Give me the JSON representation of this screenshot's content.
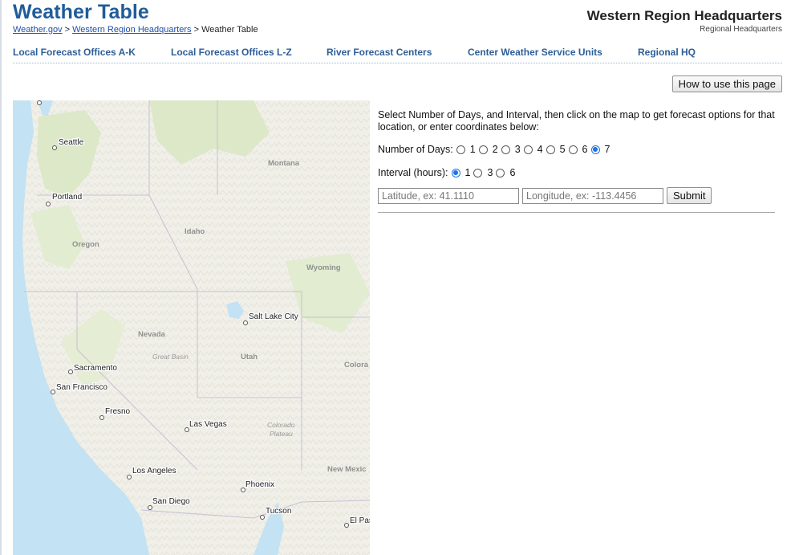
{
  "header": {
    "title": "Weather Table",
    "breadcrumb": [
      {
        "label": "Weather.gov",
        "link": true
      },
      {
        "label": "Western Region Headquarters",
        "link": true
      },
      {
        "label": "Weather Table",
        "link": false
      }
    ],
    "breadcrumb_separator": ">",
    "region_title": "Western Region Headquarters",
    "region_subtitle": "Regional Headquarters"
  },
  "nav": {
    "items": [
      {
        "label": "Local Forecast Offices A-K"
      },
      {
        "label": "Local Forecast Offices L-Z"
      },
      {
        "label": "River Forecast Centers"
      },
      {
        "label": "Center Weather Service Units"
      },
      {
        "label": "Regional HQ"
      }
    ]
  },
  "help_button": {
    "label": "How to use this page"
  },
  "form": {
    "instructions": "Select Number of Days, and Interval, then click on the map to get forecast options for that location, or enter coordinates below:",
    "days": {
      "label": "Number of Days:",
      "options": [
        "1",
        "2",
        "3",
        "4",
        "5",
        "6",
        "7"
      ],
      "selected": "7"
    },
    "interval": {
      "label": "Interval (hours):",
      "options": [
        "1",
        "3",
        "6"
      ],
      "selected": "1"
    },
    "latitude": {
      "value": "",
      "placeholder": "Latitude, ex: 41.1110"
    },
    "longitude": {
      "value": "",
      "placeholder": "Longitude, ex: -113.4456"
    },
    "submit_label": "Submit"
  },
  "map": {
    "cities": [
      {
        "name": "Seattle"
      },
      {
        "name": "Portland"
      },
      {
        "name": "Salt Lake City"
      },
      {
        "name": "Sacramento"
      },
      {
        "name": "San Francisco"
      },
      {
        "name": "Fresno"
      },
      {
        "name": "Las Vegas"
      },
      {
        "name": "Los Angeles"
      },
      {
        "name": "Phoenix"
      },
      {
        "name": "San Diego"
      },
      {
        "name": "Tucson"
      },
      {
        "name": "El Pas"
      }
    ],
    "regions": [
      {
        "name": "Montana"
      },
      {
        "name": "Idaho"
      },
      {
        "name": "Oregon"
      },
      {
        "name": "Wyoming"
      },
      {
        "name": "Nevada"
      },
      {
        "name": "Utah"
      },
      {
        "name": "Colora"
      },
      {
        "name": "New Mexic"
      }
    ],
    "features": [
      {
        "name": "Great Basin"
      },
      {
        "name": "Colorado"
      },
      {
        "name": "Plateau"
      }
    ],
    "colors": {
      "ocean": "#c3e2f3",
      "land": "#f0efe8",
      "forest": "#dce8c8",
      "border": "#c6c0d2"
    }
  }
}
